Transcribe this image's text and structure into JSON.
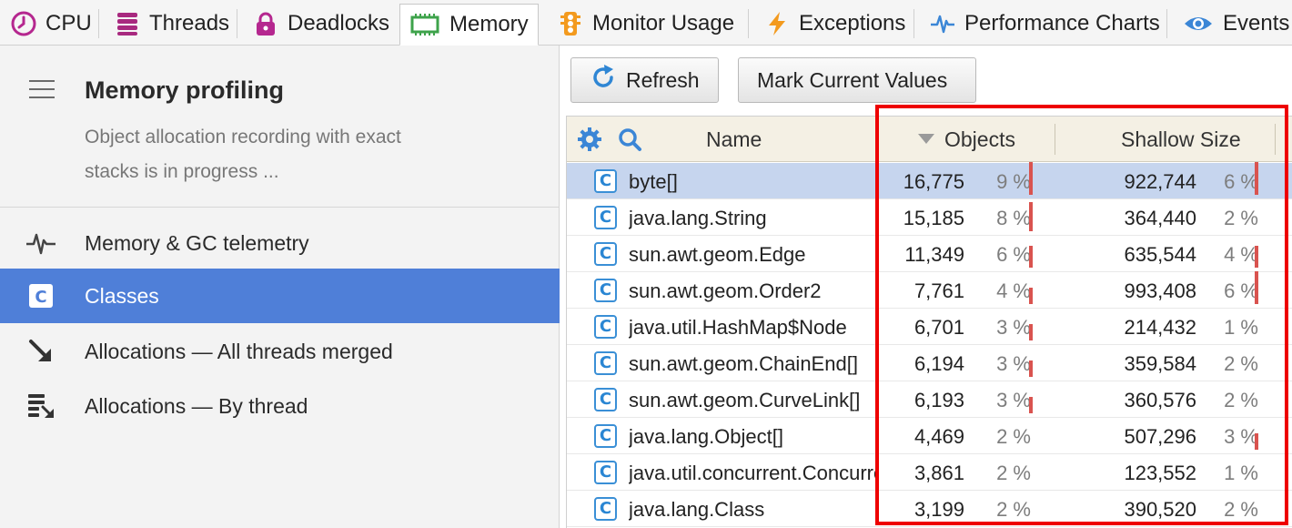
{
  "tabs": [
    {
      "label": "CPU",
      "icon": "clock-icon",
      "active": false
    },
    {
      "label": "Threads",
      "icon": "threads-stack-icon",
      "active": false
    },
    {
      "label": "Deadlocks",
      "icon": "padlock-icon",
      "active": false
    },
    {
      "label": "Memory",
      "icon": "memory-chip-icon",
      "active": true
    },
    {
      "label": "Monitor Usage",
      "icon": "traffic-light-icon",
      "active": false
    },
    {
      "label": "Exceptions",
      "icon": "lightning-icon",
      "active": false
    },
    {
      "label": "Performance Charts",
      "icon": "pulse-icon",
      "active": false
    },
    {
      "label": "Events",
      "icon": "eye-icon",
      "active": false
    }
  ],
  "panel": {
    "title": "Memory profiling",
    "description": "Object allocation recording with exact stacks is in progress ..."
  },
  "nav": [
    {
      "label": "Memory & GC telemetry",
      "icon": "pulse-icon",
      "selected": false
    },
    {
      "label": "Classes",
      "icon": "class-icon",
      "selected": true
    },
    {
      "label": "Allocations — All threads merged",
      "icon": "arrow-down-right-icon",
      "selected": false
    },
    {
      "label": "Allocations — By thread",
      "icon": "thread-allocations-icon",
      "selected": false
    }
  ],
  "toolbar": {
    "refresh_label": "Refresh",
    "mark_label": "Mark Current Values"
  },
  "table": {
    "columns": {
      "name": "Name",
      "objects": "Objects",
      "shallow_size": "Shallow Size"
    },
    "sort": {
      "column": "objects",
      "direction": "descending"
    },
    "rows": [
      {
        "name": "byte[]",
        "objects": "16,775",
        "objects_pct": "9 %",
        "size": "922,744",
        "size_pct": "6 %",
        "objects_frac": 0.09,
        "size_frac": 0.06,
        "selected": true
      },
      {
        "name": "java.lang.String",
        "objects": "15,185",
        "objects_pct": "8 %",
        "size": "364,440",
        "size_pct": "2 %",
        "objects_frac": 0.08,
        "size_frac": 0.02,
        "selected": false
      },
      {
        "name": "sun.awt.geom.Edge",
        "objects": "11,349",
        "objects_pct": "6 %",
        "size": "635,544",
        "size_pct": "4 %",
        "objects_frac": 0.06,
        "size_frac": 0.04,
        "selected": false
      },
      {
        "name": "sun.awt.geom.Order2",
        "objects": "7,761",
        "objects_pct": "4 %",
        "size": "993,408",
        "size_pct": "6 %",
        "objects_frac": 0.04,
        "size_frac": 0.06,
        "selected": false
      },
      {
        "name": "java.util.HashMap$Node",
        "objects": "6,701",
        "objects_pct": "3 %",
        "size": "214,432",
        "size_pct": "1 %",
        "objects_frac": 0.03,
        "size_frac": 0.01,
        "selected": false
      },
      {
        "name": "sun.awt.geom.ChainEnd[]",
        "objects": "6,194",
        "objects_pct": "3 %",
        "size": "359,584",
        "size_pct": "2 %",
        "objects_frac": 0.03,
        "size_frac": 0.02,
        "selected": false
      },
      {
        "name": "sun.awt.geom.CurveLink[]",
        "objects": "6,193",
        "objects_pct": "3 %",
        "size": "360,576",
        "size_pct": "2 %",
        "objects_frac": 0.03,
        "size_frac": 0.02,
        "selected": false
      },
      {
        "name": "java.lang.Object[]",
        "objects": "4,469",
        "objects_pct": "2 %",
        "size": "507,296",
        "size_pct": "3 %",
        "objects_frac": 0.02,
        "size_frac": 0.03,
        "selected": false
      },
      {
        "name": "java.util.concurrent.ConcurrentHashMap$Node",
        "objects": "3,861",
        "objects_pct": "2 %",
        "size": "123,552",
        "size_pct": "1 %",
        "objects_frac": 0.02,
        "size_frac": 0.01,
        "selected": false
      },
      {
        "name": "java.lang.Class",
        "objects": "3,199",
        "objects_pct": "2 %",
        "size": "390,520",
        "size_pct": "2 %",
        "objects_frac": 0.02,
        "size_frac": 0.02,
        "selected": false
      }
    ]
  },
  "colors": {
    "accent": "#4f7fd8",
    "selected_row": "#c6d5ee",
    "bar": "#d9534f",
    "highlight_box": "#ee0000"
  }
}
